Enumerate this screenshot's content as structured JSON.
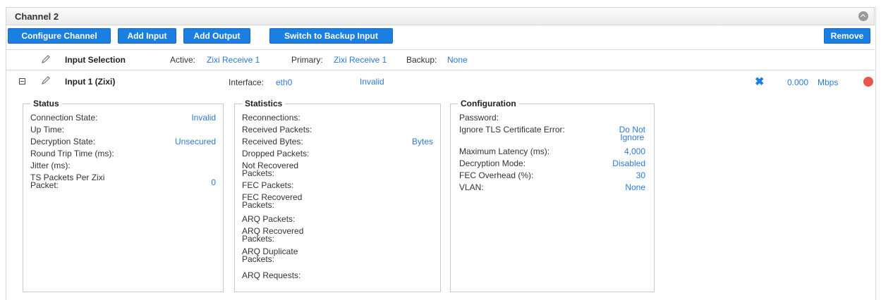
{
  "channel": {
    "title": "Channel 2"
  },
  "toolbar": {
    "configure": "Configure Channel",
    "add_input": "Add Input",
    "add_output": "Add Output",
    "switch_backup": "Switch to Backup Input",
    "remove": "Remove"
  },
  "input_selection": {
    "label": "Input Selection",
    "active_label": "Active:",
    "active_value": "Zixi Receive 1",
    "primary_label": "Primary:",
    "primary_value": "Zixi Receive 1",
    "backup_label": "Backup:",
    "backup_value": "None"
  },
  "input1": {
    "name": "Input 1 (Zixi)",
    "interface_label": "Interface:",
    "interface_value": "eth0",
    "state": "Invalid",
    "rate": "0.000",
    "rate_unit": "Mbps",
    "status_color": "#e8574a"
  },
  "status": {
    "title": "Status",
    "items": [
      {
        "label": "Connection State:",
        "value": "Invalid"
      },
      {
        "label": "Up Time:",
        "value": ""
      },
      {
        "label": "Decryption State:",
        "value": "Unsecured"
      },
      {
        "label": "Round Trip Time (ms):",
        "value": ""
      },
      {
        "label": "Jitter (ms):",
        "value": ""
      },
      {
        "label": "TS Packets Per Zixi\nPacket:",
        "value": "0"
      }
    ]
  },
  "statistics": {
    "title": "Statistics",
    "items": [
      {
        "label": "Reconnections:",
        "value": ""
      },
      {
        "label": "Received Packets:",
        "value": ""
      },
      {
        "label": "Received Bytes:",
        "value": "Bytes"
      },
      {
        "label": "Dropped Packets:",
        "value": ""
      },
      {
        "label": "Not Recovered\nPackets:",
        "value": ""
      },
      {
        "label": "FEC Packets:",
        "value": ""
      },
      {
        "label": "FEC Recovered\nPackets:",
        "value": ""
      },
      {
        "label": "ARQ Packets:",
        "value": ""
      },
      {
        "label": "ARQ Recovered\nPackets:",
        "value": ""
      },
      {
        "label": "ARQ Duplicate\nPackets:",
        "value": ""
      },
      {
        "label": "ARQ Requests:",
        "value": ""
      }
    ]
  },
  "configuration": {
    "title": "Configuration",
    "items": [
      {
        "label": "Password:",
        "value": ""
      },
      {
        "label": "Ignore TLS Certificate Error:",
        "value": "Do Not\nIgnore"
      },
      {
        "label": "Maximum Latency (ms):",
        "value": "4,000"
      },
      {
        "label": "Decryption Mode:",
        "value": "Disabled"
      },
      {
        "label": "FEC Overhead (%):",
        "value": "30"
      },
      {
        "label": "VLAN:",
        "value": "None"
      }
    ]
  },
  "colors": {
    "accent": "#1a7fe0",
    "link": "#2c7ad6",
    "status_red": "#e8574a"
  }
}
